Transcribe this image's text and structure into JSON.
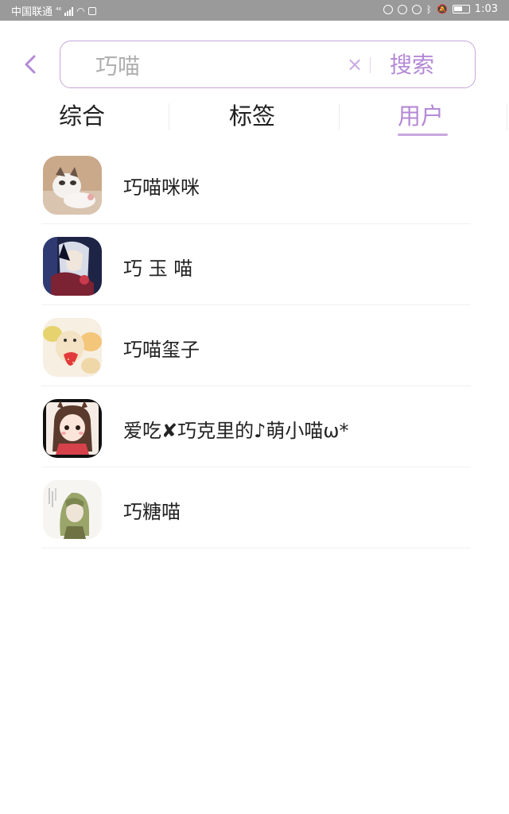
{
  "status_bar": {
    "carrier": "中国联通",
    "network": "⁴⁶",
    "time": "1:03"
  },
  "search": {
    "query": "巧喵",
    "clear_symbol": "×",
    "button_label": "搜索"
  },
  "tabs": [
    {
      "label": "综合"
    },
    {
      "label": "标签"
    },
    {
      "label": "用户"
    }
  ],
  "users": [
    {
      "name": "巧喵咪咪",
      "avatar": "cat-photo-avatar"
    },
    {
      "name": " 巧 玉 喵",
      "avatar": "anime-illustration-avatar"
    },
    {
      "name": "巧喵玺子",
      "avatar": "hamster-strawberry-avatar"
    },
    {
      "name": "爱吃✘巧克里的♪萌小喵ω*",
      "avatar": "cartoon-girl-avatar"
    },
    {
      "name": "巧糖喵",
      "avatar": "green-hair-sketch-avatar"
    }
  ],
  "colors": {
    "accent": "#b489d6",
    "status_bar": "#9a9a9a"
  }
}
